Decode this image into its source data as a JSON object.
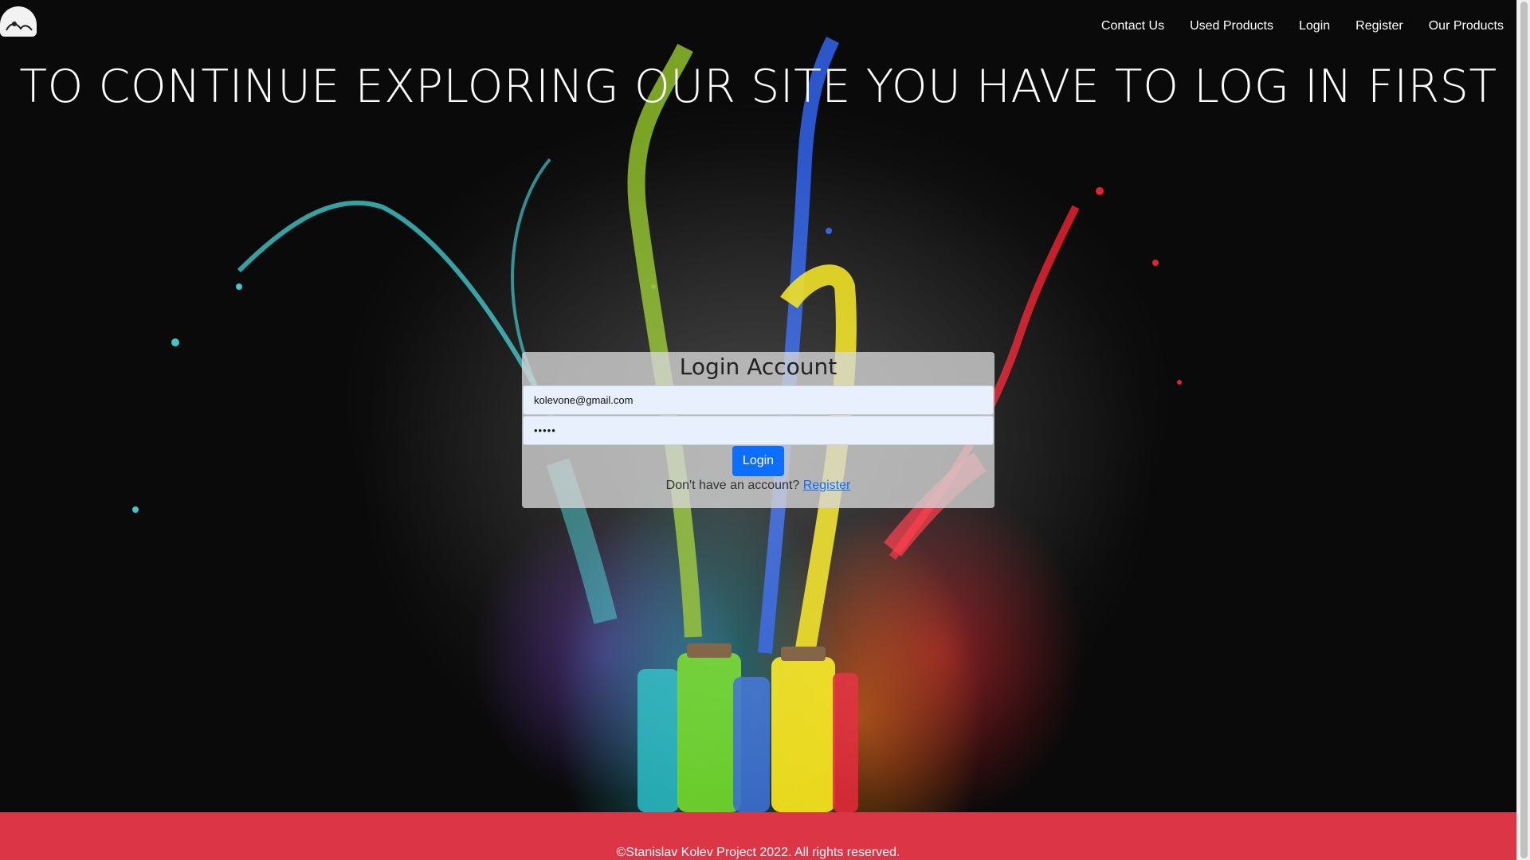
{
  "nav": {
    "items": [
      "Contact Us",
      "Used Products",
      "Login",
      "Register",
      "Our Products"
    ]
  },
  "hero": {
    "title": "TO CONTINUE EXPLORING OUR SITE YOU HAVE TO LOG IN FIRST"
  },
  "login_card": {
    "title": "Login Account",
    "email_value": "kolevone@gmail.com",
    "password_value": "•••••",
    "login_label": "Login",
    "signup_prompt": "Don't have an account?",
    "register_link": "Register"
  },
  "footer": {
    "text": "©Stanislav Kolev Project 2022. All rights reserved."
  },
  "colors": {
    "login_button": "#0d6efd",
    "footer_bg": "#dc3545",
    "input_bg": "#e8f0fe"
  }
}
